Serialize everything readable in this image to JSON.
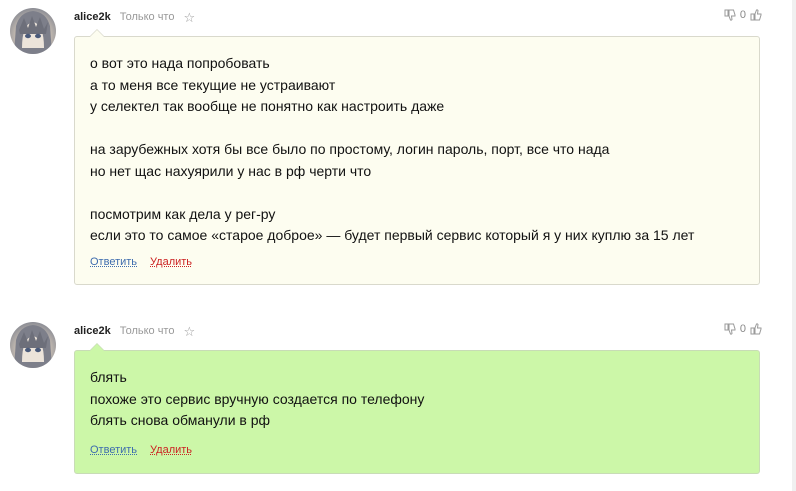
{
  "comments": [
    {
      "author": "alice2k",
      "time": "Только что",
      "votes": "0",
      "lines": [
        "о вот это нада попробовать",
        "а то меня все текущие не устраивают",
        "у селектел так вообще не понятно как настроить даже",
        "",
        "на зарубежных хотя бы все было по простому, логин пароль, порт, все что нада",
        "но нет щас нахуярили у нас в рф черти что",
        "",
        "посмотрим как дела у рег-ру",
        "если это то самое «старое доброе» — будет первый сервис который я у них куплю за 15 лет"
      ],
      "reply_label": "Ответить",
      "delete_label": "Удалить"
    },
    {
      "author": "alice2k",
      "time": "Только что",
      "votes": "0",
      "lines": [
        "блять",
        "похоже это сервис вручную создается по телефону",
        "блять снова обманули в рф"
      ],
      "reply_label": "Ответить",
      "delete_label": "Удалить"
    }
  ],
  "colors": {
    "bubble_default": "#fdfdf0",
    "bubble_highlight": "#ccf7a8",
    "link": "#3d6cae",
    "delete": "#cc2222"
  },
  "icons": [
    "avatar-image",
    "star-icon",
    "thumbs-down-icon",
    "thumbs-up-icon"
  ]
}
